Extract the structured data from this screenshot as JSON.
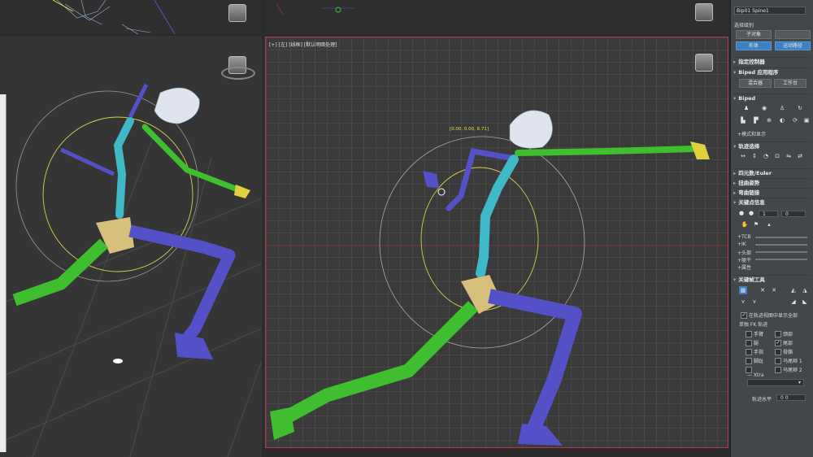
{
  "viewport": {
    "label": "[+] [左] [线框] [默认明暗处理]",
    "coordinate_readout": "[0.00, 0.00, 6.71]"
  },
  "panel": {
    "object_name": "Bip01 Spine1",
    "selection_level_label": "选择级别",
    "sub_object_button": "子对象",
    "body_button": "形体",
    "keyframe_button": "运动路径",
    "assign_controller": "指定控制器",
    "biped_apps": "Biped 应用程序",
    "mixer_button": "混合器",
    "workbench_button": "工作台",
    "biped_rollout": "Biped",
    "mode_display": "+模式和显示",
    "track_selection": "轨迹选择",
    "quaternion_euler": "四元数/Euler",
    "twist_pose": "扭曲姿势",
    "bend_links": "弯曲链接",
    "key_info": "关键点信息",
    "key_number": "1",
    "key_value": "0",
    "tcb_items": [
      "+TCB",
      "+IK",
      "+头部",
      "+躯干",
      "+属性"
    ],
    "keyframe_tools": "关键帧工具",
    "show_all_trajectories": "在轨迹视图中显示全部",
    "separate_fk_tracks": "单独 FK 轨迹",
    "fk_tracks": [
      {
        "label": "手臂",
        "checked": false
      },
      {
        "label": "颈部",
        "checked": false
      },
      {
        "label": "腿",
        "checked": false
      },
      {
        "label": "尾部",
        "checked": true
      },
      {
        "label": "手指",
        "checked": false
      },
      {
        "label": "骨骼",
        "checked": false
      },
      {
        "label": "脚趾",
        "checked": false
      },
      {
        "label": "马尾辫 1",
        "checked": false
      },
      {
        "label": "",
        "checked": false
      },
      {
        "label": "马尾辫 2",
        "checked": false
      }
    ],
    "extra_label": "— Xtra",
    "anchor_level_label": "轨迹水平",
    "anchor_level_value": "0 0"
  },
  "colors": {
    "accent_blue": "#3d7fc0",
    "active_border": "#b33a4a",
    "limb_green": "#3fbf2f",
    "limb_blue": "#5450c8",
    "spine_cyan": "#3fb8c8",
    "pelvis_tan": "#d8c07c",
    "head_white": "#dfe4ee"
  }
}
